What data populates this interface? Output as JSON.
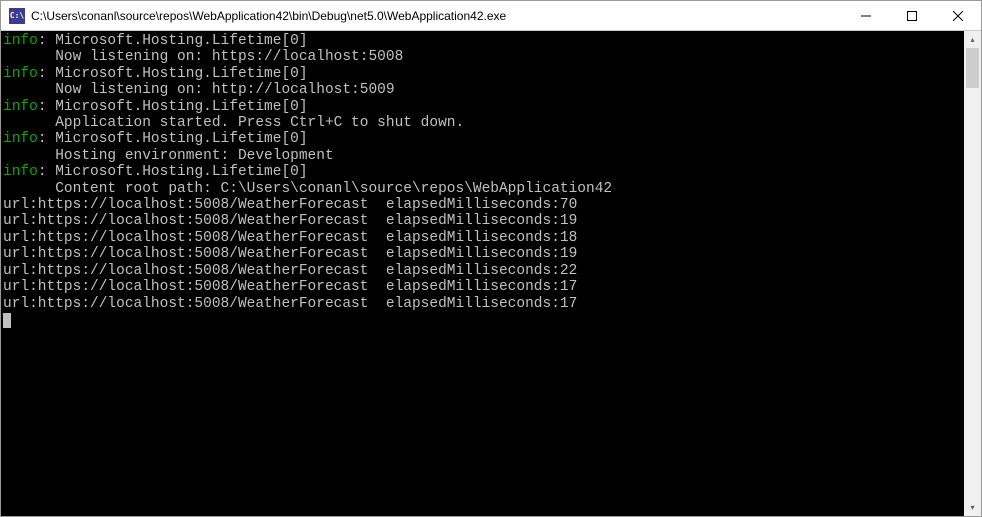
{
  "window": {
    "icon_label": "C:\\",
    "title": "C:\\Users\\conanl\\source\\repos\\WebApplication42\\bin\\Debug\\net5.0\\WebApplication42.exe"
  },
  "log": {
    "lines": [
      {
        "level": "info",
        "source": "Microsoft.Hosting.Lifetime[0]",
        "message": "Now listening on: https://localhost:5008"
      },
      {
        "level": "info",
        "source": "Microsoft.Hosting.Lifetime[0]",
        "message": "Now listening on: http://localhost:5009"
      },
      {
        "level": "info",
        "source": "Microsoft.Hosting.Lifetime[0]",
        "message": "Application started. Press Ctrl+C to shut down."
      },
      {
        "level": "info",
        "source": "Microsoft.Hosting.Lifetime[0]",
        "message": "Hosting environment: Development"
      },
      {
        "level": "info",
        "source": "Microsoft.Hosting.Lifetime[0]",
        "message": "Content root path: C:\\Users\\conanl\\source\\repos\\WebApplication42"
      }
    ],
    "requests": [
      {
        "url": "https://localhost:5008/WeatherForecast",
        "elapsedMilliseconds": 70
      },
      {
        "url": "https://localhost:5008/WeatherForecast",
        "elapsedMilliseconds": 19
      },
      {
        "url": "https://localhost:5008/WeatherForecast",
        "elapsedMilliseconds": 18
      },
      {
        "url": "https://localhost:5008/WeatherForecast",
        "elapsedMilliseconds": 19
      },
      {
        "url": "https://localhost:5008/WeatherForecast",
        "elapsedMilliseconds": 22
      },
      {
        "url": "https://localhost:5008/WeatherForecast",
        "elapsedMilliseconds": 17
      },
      {
        "url": "https://localhost:5008/WeatherForecast",
        "elapsedMilliseconds": 17
      }
    ]
  }
}
